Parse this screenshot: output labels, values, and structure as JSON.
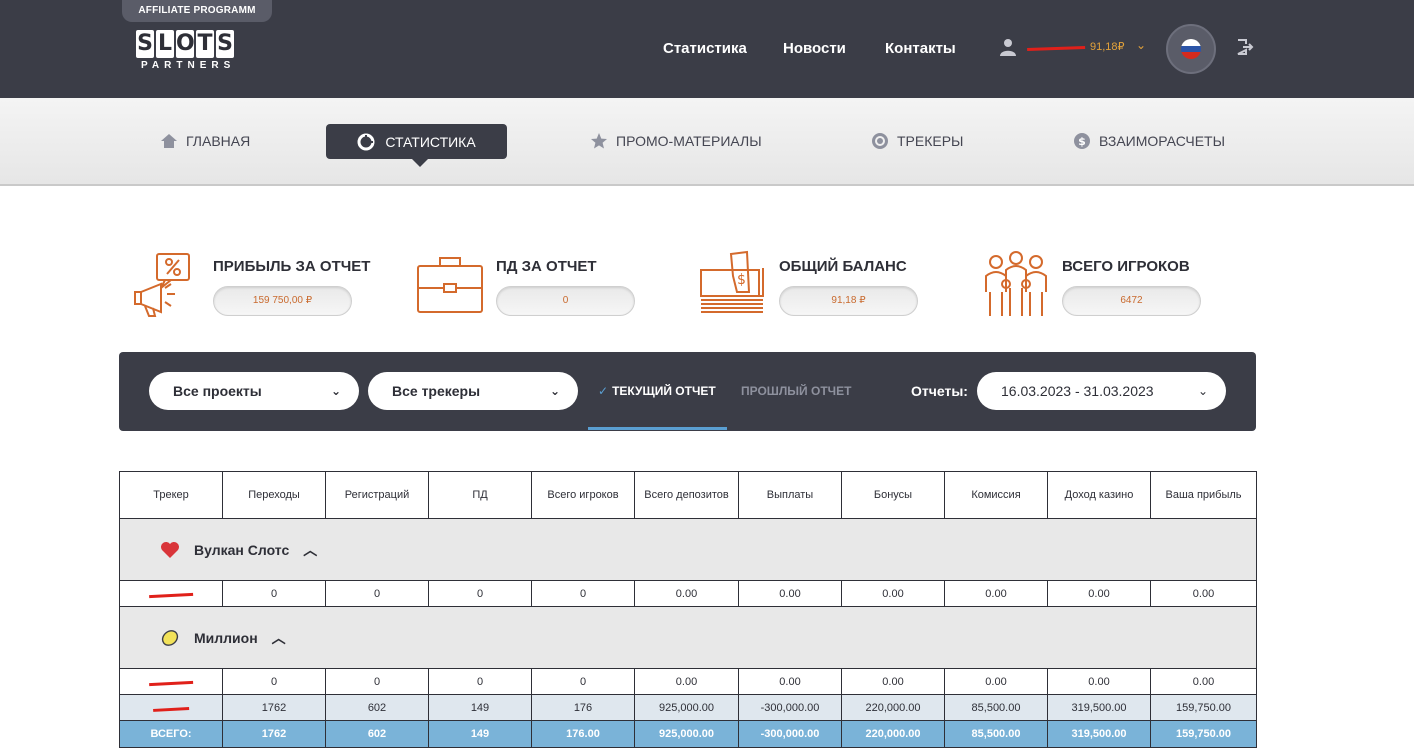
{
  "header": {
    "affiliate_tab": "AFFILIATE PROGRAMM",
    "logo_letters": [
      "S",
      "L",
      "O",
      "T",
      "S"
    ],
    "logo_sub": "PARTNERS",
    "nav": [
      "Статистика",
      "Новости",
      "Контакты"
    ],
    "balance": "91,18₽",
    "accent": "#e3a23a",
    "bg": "#3b3d47"
  },
  "subnav": {
    "items": [
      "ГЛАВНАЯ",
      "СТАТИСТИКА",
      "ПРОМО-МАТЕРИАЛЫ",
      "ТРЕКЕРЫ",
      "ВЗАИМОРАСЧЕТЫ"
    ],
    "active": "СТАТИСТИКА"
  },
  "cards": [
    {
      "title": "ПРИБЫЛЬ ЗА ОТЧЕТ",
      "value": "159 750,00 ₽",
      "icon": "megaphone-percent-icon"
    },
    {
      "title": "ПД ЗА ОТЧЕТ",
      "value": "0",
      "icon": "briefcase-icon"
    },
    {
      "title": "ОБЩИЙ БАЛАНС",
      "value": "91,18 ₽",
      "icon": "money-stack-icon"
    },
    {
      "title": "ВСЕГО ИГРОКОВ",
      "value": "6472",
      "icon": "group-people-icon"
    }
  ],
  "filter": {
    "projects": "Все проекты",
    "trackers": "Все трекеры",
    "current_tab": "ТЕКУЩИЙ ОТЧЕТ",
    "prev_tab": "ПРОШЛЫЙ ОТЧЕТ",
    "reports_label": "Отчеты:",
    "date_range": "16.03.2023 - 31.03.2023"
  },
  "table": {
    "columns": [
      "Трекер",
      "Переходы",
      "Регистраций",
      "ПД",
      "Всего игроков",
      "Всего депозитов",
      "Выплаты",
      "Бонусы",
      "Комиссия",
      "Доход казино",
      "Ваша прибыль"
    ],
    "groups": [
      {
        "name": "Вулкан Слотс",
        "rows": [
          [
            "0",
            "0",
            "0",
            "0",
            "0.00",
            "0.00",
            "0.00",
            "0.00",
            "0.00",
            "0.00"
          ]
        ]
      },
      {
        "name": "Миллион",
        "rows": [
          [
            "0",
            "0",
            "0",
            "0",
            "0.00",
            "0.00",
            "0.00",
            "0.00",
            "0.00",
            "0.00"
          ],
          [
            "1762",
            "602",
            "149",
            "176",
            "925,000.00",
            "-300,000.00",
            "220,000.00",
            "85,500.00",
            "319,500.00",
            "159,750.00"
          ]
        ]
      }
    ],
    "total_label": "ВСЕГО:",
    "total": [
      "1762",
      "602",
      "149",
      "176.00",
      "925,000.00",
      "-300,000.00",
      "220,000.00",
      "85,500.00",
      "319,500.00",
      "159,750.00"
    ]
  }
}
